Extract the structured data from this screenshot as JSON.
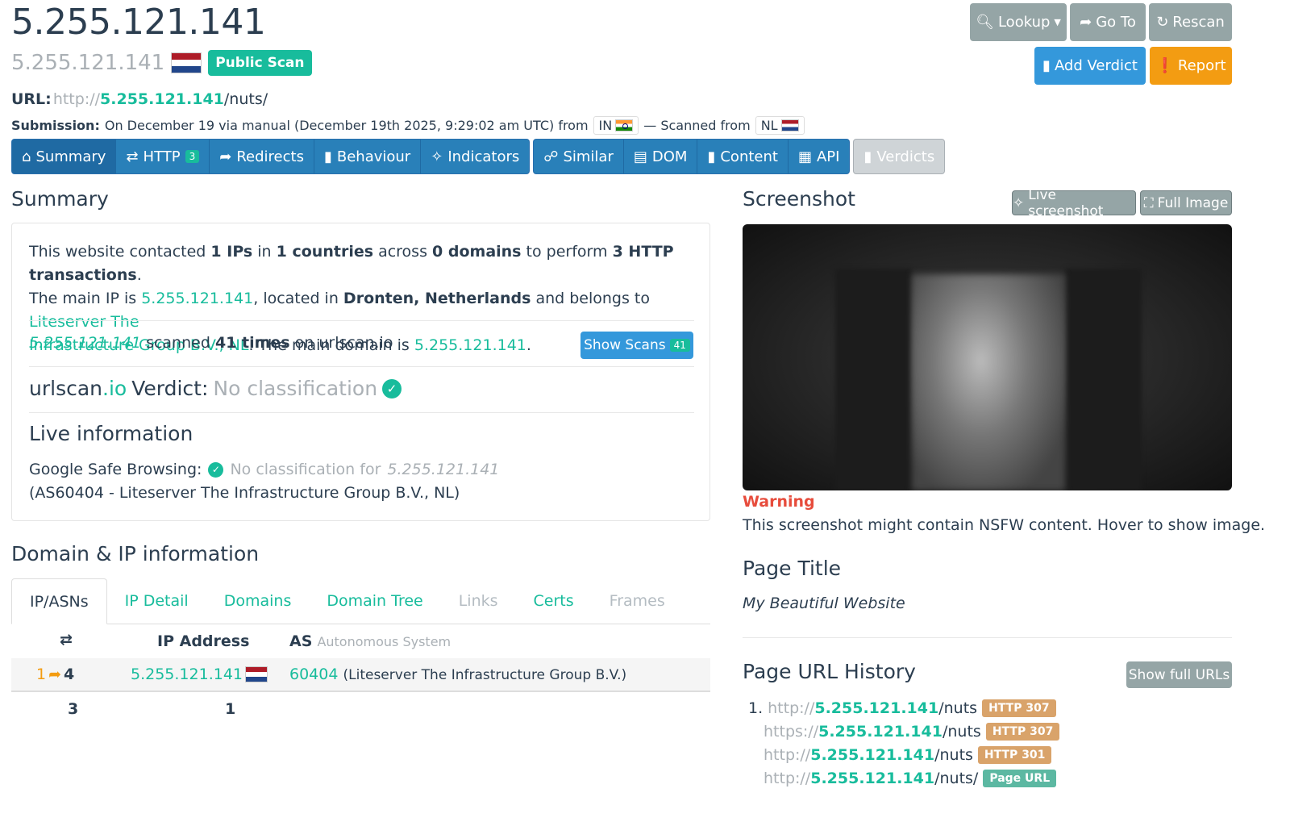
{
  "header": {
    "title": "5.255.121.141",
    "subtitle": "5.255.121.141",
    "public_badge": "Public Scan",
    "url_label": "URL:",
    "url_scheme": "http://",
    "url_host": "5.255.121.141",
    "url_path": "/nuts/",
    "submission_label": "Submission:",
    "submission_text": "On December 19 via manual (December 19th 2025, 9:29:02 am UTC) from",
    "from_country": "IN",
    "scanned_from_text": "— Scanned from",
    "scanned_country": "NL"
  },
  "actions": {
    "lookup": "Lookup",
    "goto": "Go To",
    "rescan": "Rescan",
    "add_verdict": "Add Verdict",
    "report": "Report"
  },
  "tabs": {
    "summary": "Summary",
    "http": "HTTP",
    "http_count": "3",
    "redirects": "Redirects",
    "behaviour": "Behaviour",
    "indicators": "Indicators",
    "similar": "Similar",
    "dom": "DOM",
    "content": "Content",
    "api": "API",
    "verdicts": "Verdicts"
  },
  "summary": {
    "heading": "Summary",
    "s1": "This website contacted",
    "ips": "1 IPs",
    "s2": "in",
    "countries": "1 countries",
    "s3": "across",
    "domains": "0 domains",
    "s4": "to perform",
    "transactions": "3 HTTP transactions",
    "s5": ".",
    "s6": "The main IP is",
    "main_ip": "5.255.121.141",
    "s7": ", located in",
    "location": "Dronten, Netherlands",
    "s8": "and belongs to",
    "owner_a": "Liteserver The",
    "owner_b": "Infrastructure Group B.V., NL",
    "s9": ". The main domain is",
    "main_domain": "5.255.121.141",
    "s10": ".",
    "scan_ip": "5.255.121.141",
    "scanned_text": "scanned",
    "scan_times": "41 times",
    "scan_suffix": "on urlscan.io",
    "show_scans": "Show Scans",
    "show_scans_count": "41",
    "verdict_brand_a": "urlscan",
    "verdict_brand_b": ".io",
    "verdict_label": "Verdict:",
    "verdict_value": "No classification",
    "live_heading": "Live information",
    "gsb_label": "Google Safe Browsing:",
    "gsb_value": "No classification for",
    "gsb_ip": "5.255.121.141",
    "asn_note": "(AS60404 - Liteserver The Infrastructure Group B.V., NL)"
  },
  "domain_ip": {
    "heading": "Domain & IP information",
    "tabs": [
      "IP/ASNs",
      "IP Detail",
      "Domains",
      "Domain Tree",
      "Links",
      "Certs",
      "Frames"
    ],
    "col_ip": "IP Address",
    "col_as": "AS",
    "col_as_sub": "Autonomous System",
    "row_count_a": "1",
    "row_count_b": "4",
    "row_ip": "5.255.121.141",
    "row_asn": "60404",
    "row_as_name": "(Liteserver The Infrastructure Group B.V.)",
    "total_requests": "3",
    "total_ips": "1"
  },
  "screenshot": {
    "heading": "Screenshot",
    "live_btn": "Live screenshot",
    "full_btn": "Full Image",
    "warning": "Warning",
    "warning_text": "This screenshot might contain NSFW content. Hover to show image."
  },
  "page_title": {
    "heading": "Page Title",
    "value": "My Beautiful Website"
  },
  "history": {
    "heading": "Page URL History",
    "show_full": "Show full URLs",
    "num": "1.",
    "items": [
      {
        "scheme": "http://",
        "host": "5.255.121.141",
        "path": "/nuts",
        "badge": "HTTP 307"
      },
      {
        "scheme": "https://",
        "host": "5.255.121.141",
        "path": "/nuts",
        "badge": "HTTP 307"
      },
      {
        "scheme": "http://",
        "host": "5.255.121.141",
        "path": "/nuts",
        "badge": "HTTP 301"
      },
      {
        "scheme": "http://",
        "host": "5.255.121.141",
        "path": "/nuts/",
        "badge": "Page URL"
      }
    ]
  },
  "colors": {
    "accent_green": "#18bc9c",
    "nav_blue": "#2980b9",
    "button_gray": "#95a5a6",
    "button_blue": "#3498db",
    "button_orange": "#f39c12",
    "warning_red": "#e74c3c",
    "http_badge": "#d9a36a"
  }
}
